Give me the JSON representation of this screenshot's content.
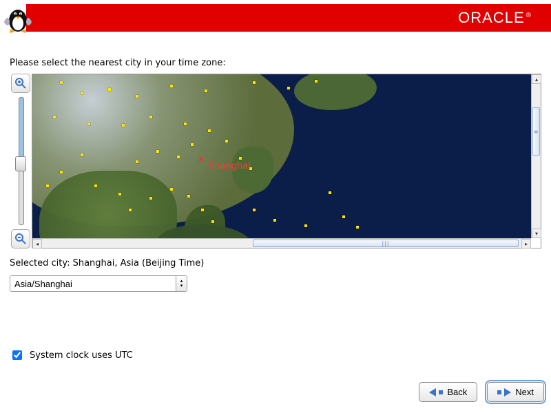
{
  "header": {
    "brand": "ORACLE"
  },
  "prompt": "Please select the nearest city in your time zone:",
  "map": {
    "marker_label": "Shanghai"
  },
  "selected_city_label": "Selected city: Shanghai, Asia (Beijing Time)",
  "timezone_combo": {
    "value": "Asia/Shanghai"
  },
  "utc": {
    "checked": true,
    "label": "System clock uses UTC"
  },
  "buttons": {
    "back": "Back",
    "next": "Next"
  }
}
